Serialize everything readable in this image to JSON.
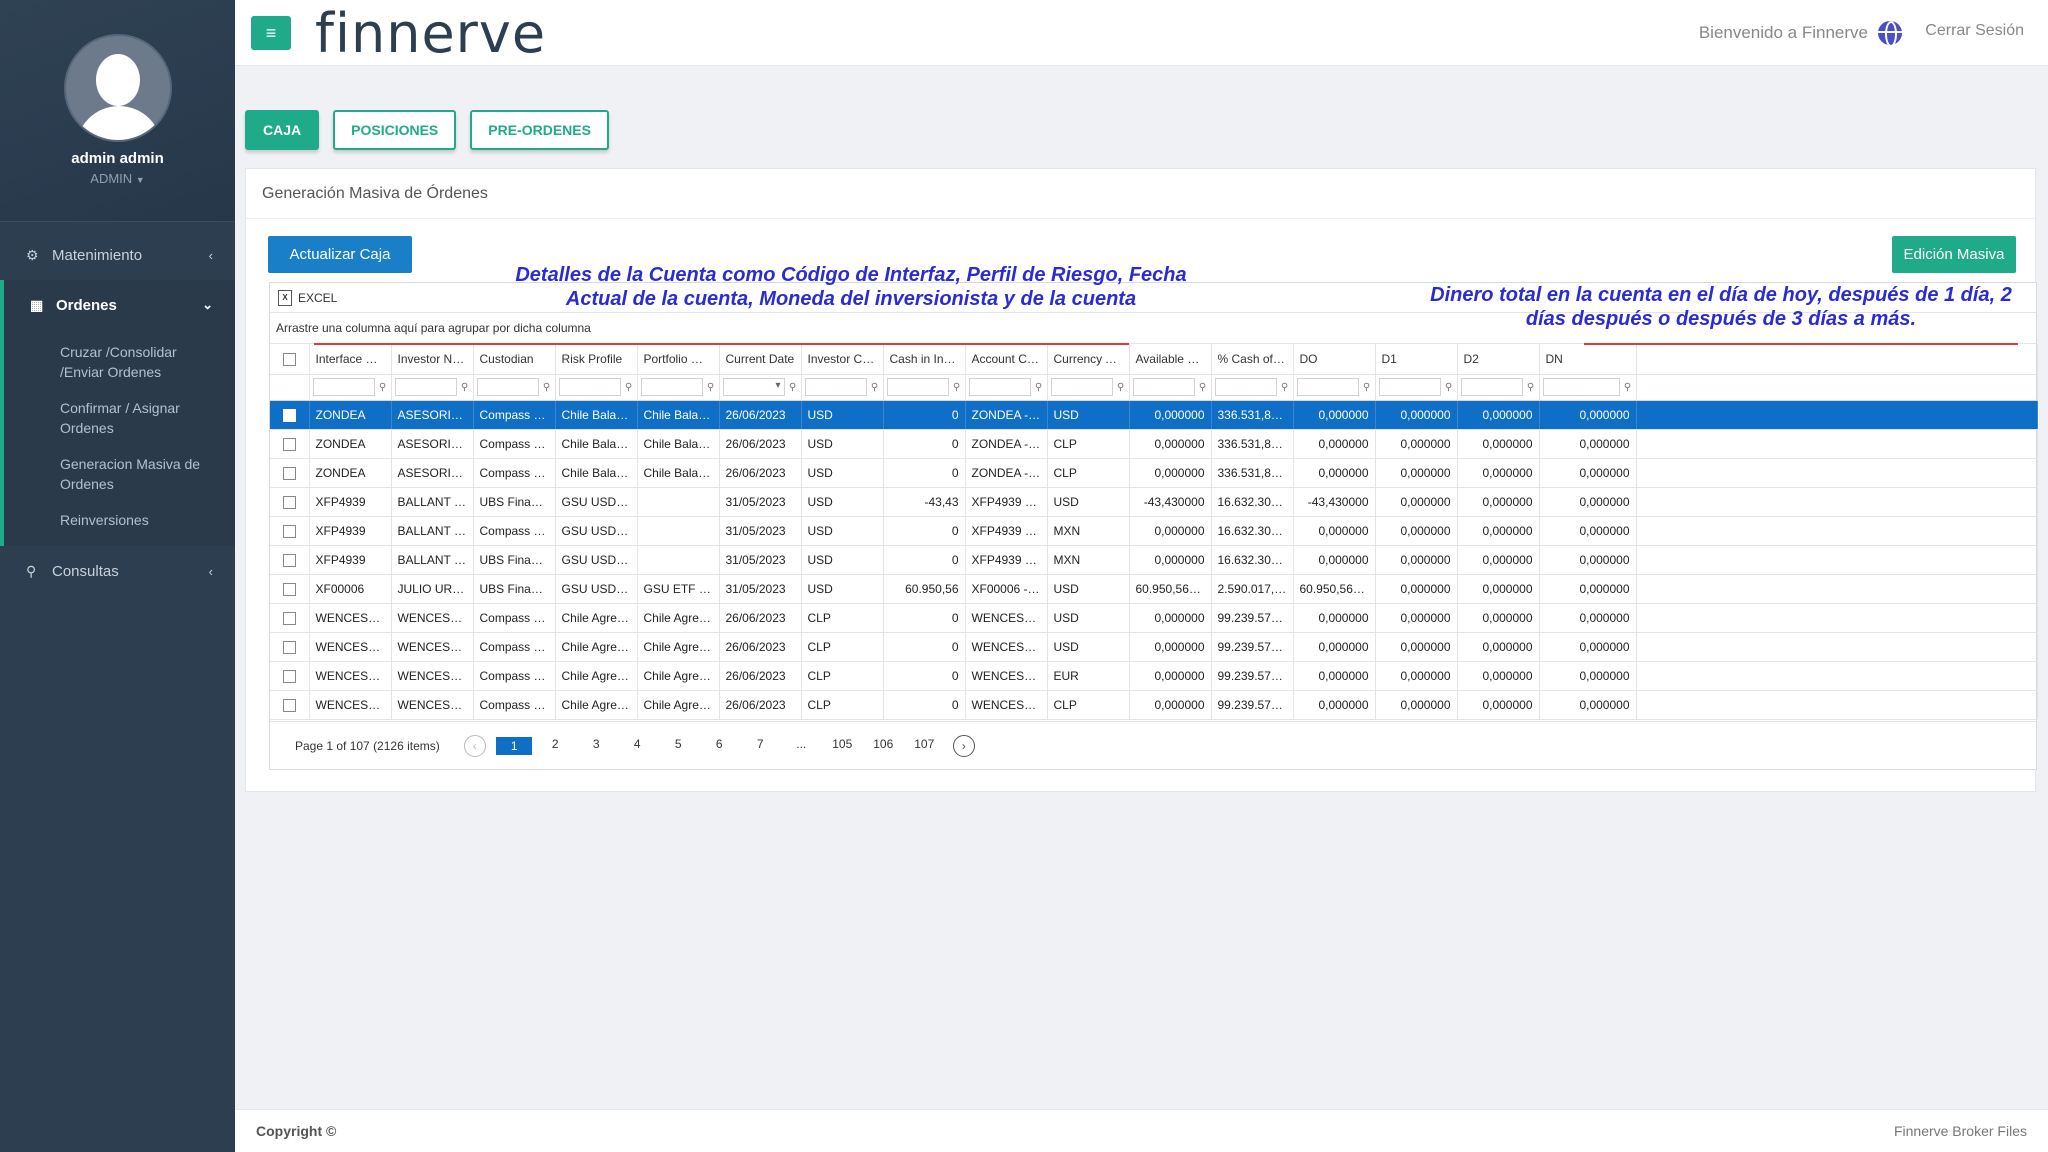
{
  "app": {
    "brand": "finnerve",
    "welcome": "Bienvenido a Finnerve",
    "logout": "Cerrar Sesión",
    "menu_icon": "≡"
  },
  "user": {
    "name": "admin admin",
    "role": "ADMIN"
  },
  "sidebar": {
    "items": [
      {
        "label": "Matenimiento",
        "icon": "gears-icon"
      },
      {
        "label": "Ordenes",
        "icon": "grid-icon"
      },
      {
        "label": "Consultas",
        "icon": "search-icon"
      }
    ],
    "sub_items": [
      {
        "label": "Cruzar /Consolidar /Enviar Ordenes"
      },
      {
        "label": "Confirmar / Asignar Ordenes"
      },
      {
        "label": "Generacion Masiva de Ordenes"
      },
      {
        "label": "Reinversiones"
      }
    ]
  },
  "tabs": [
    {
      "label": "CAJA"
    },
    {
      "label": "POSICIONES"
    },
    {
      "label": "PRE-ORDENES"
    }
  ],
  "panel": {
    "title": "Generación Masiva de Órdenes",
    "update_button": "Actualizar Caja",
    "bulk_edit_button": "Edición Masiva"
  },
  "annotations": {
    "left": "Detalles de la Cuenta como Código de Interfaz, Perfil de Riesgo, Fecha Actual de la cuenta, Moneda del inversionista y de la cuenta",
    "right": "Dinero total en la cuenta en el día de hoy, después de 1 día, 2 días después o  después de 3 días a más.",
    "color": "#2b2bd4",
    "line_color": "#e23a3a"
  },
  "grid": {
    "excel_label": "EXCEL",
    "group_hint": "Arrastre una columna aquí para agrupar por dicha columna",
    "columns": [
      "Interface Code",
      "Investor Name",
      "Custodian",
      "Risk Profile",
      "Portfolio Model",
      "Current Date",
      "Investor Curre...",
      "Cash in Invest...",
      "Account Co...",
      "Currency Acc...",
      "Available Cash",
      "% Cash of NAV",
      "DO",
      "D1",
      "D2",
      "DN"
    ],
    "rows": [
      [
        "ZONDEA",
        "ASESORIAS E I...",
        "Compass Group",
        "Chile Balancea...",
        "Chile Balancea...",
        "26/06/2023",
        "USD",
        "0",
        "ZONDEA - USD",
        "USD",
        "0,000000",
        "336.531,852000",
        "0,000000",
        "0,000000",
        "0,000000",
        "0,000000"
      ],
      [
        "ZONDEA",
        "ASESORIAS E I...",
        "Compass Group",
        "Chile Balancea...",
        "Chile Balancea...",
        "26/06/2023",
        "USD",
        "0",
        "ZONDEA - CLP",
        "CLP",
        "0,000000",
        "336.531,852000",
        "0,000000",
        "0,000000",
        "0,000000",
        "0,000000"
      ],
      [
        "ZONDEA",
        "ASESORIAS E I...",
        "Compass Group",
        "Chile Balancea...",
        "Chile Balancea...",
        "26/06/2023",
        "USD",
        "0",
        "ZONDEA - CLP",
        "CLP",
        "0,000000",
        "336.531,852000",
        "0,000000",
        "0,000000",
        "0,000000",
        "0,000000"
      ],
      [
        "XFP4939",
        "BALLANT LIMI...",
        "UBS Financial ...",
        "GSU USD Bala...",
        "",
        "31/05/2023",
        "USD",
        "-43,43",
        "XFP4939 - USD",
        "USD",
        "-43,430000",
        "16.632.307,843...",
        "-43,430000",
        "0,000000",
        "0,000000",
        "0,000000"
      ],
      [
        "XFP4939",
        "BALLANT LIMI...",
        "Compass Group",
        "GSU USD Bala...",
        "",
        "31/05/2023",
        "USD",
        "0",
        "XFP4939 - MXN",
        "MXN",
        "0,000000",
        "16.632.307,843...",
        "0,000000",
        "0,000000",
        "0,000000",
        "0,000000"
      ],
      [
        "XFP4939",
        "BALLANT LIMI...",
        "UBS Financial ...",
        "GSU USD Bala...",
        "",
        "31/05/2023",
        "USD",
        "0",
        "XFP4939 - MXN",
        "MXN",
        "0,000000",
        "16.632.307,843...",
        "0,000000",
        "0,000000",
        "0,000000",
        "0,000000"
      ],
      [
        "XF00006",
        "JULIO URIBE B...",
        "UBS Financial ...",
        "GSU USD Cons...",
        "GSU ETF SIC A...",
        "31/05/2023",
        "USD",
        "60.950,56",
        "XF00006 - USD",
        "USD",
        "60.950,560000",
        "2.590.017,987400",
        "60.950,560000",
        "0,000000",
        "0,000000",
        "0,000000"
      ],
      [
        "WENCESLAO ...",
        "WENCESLAO J...",
        "Compass Group",
        "Chile Agresivo...",
        "Chile Agresivo",
        "26/06/2023",
        "CLP",
        "0",
        "WENCESLAO ...",
        "USD",
        "0,000000",
        "99.239.570,513...",
        "0,000000",
        "0,000000",
        "0,000000",
        "0,000000"
      ],
      [
        "WENCESLAO ...",
        "WENCESLAO J...",
        "Compass Group",
        "Chile Agresivo...",
        "Chile Agresivo",
        "26/06/2023",
        "CLP",
        "0",
        "WENCESLAO ...",
        "USD",
        "0,000000",
        "99.239.570,513...",
        "0,000000",
        "0,000000",
        "0,000000",
        "0,000000"
      ],
      [
        "WENCESLAO ...",
        "WENCESLAO J...",
        "Compass Group",
        "Chile Agresivo...",
        "Chile Agresivo",
        "26/06/2023",
        "CLP",
        "0",
        "WENCESLAO ...",
        "EUR",
        "0,000000",
        "99.239.570,513...",
        "0,000000",
        "0,000000",
        "0,000000",
        "0,000000"
      ],
      [
        "WENCESLAO ...",
        "WENCESLAO J...",
        "Compass Group",
        "Chile Agresivo...",
        "Chile Agresivo",
        "26/06/2023",
        "CLP",
        "0",
        "WENCESLAO ...",
        "CLP",
        "0,000000",
        "99.239.570,513...",
        "0,000000",
        "0,000000",
        "0,000000",
        "0,000000"
      ]
    ],
    "selected_row": 0,
    "pager": {
      "info": "Page 1 of 107 (2126 items)",
      "pages": [
        "1",
        "2",
        "3",
        "4",
        "5",
        "6",
        "7",
        "...",
        "105",
        "106",
        "107"
      ],
      "current": "1"
    }
  },
  "footer": {
    "copyright": "Copyright ©",
    "right": "Finnerve Broker Files"
  },
  "colors": {
    "accent_green": "#1fab89",
    "primary_blue": "#1a7fc9",
    "selected_row": "#0f6fc6",
    "sidebar": "#2d3e50"
  }
}
